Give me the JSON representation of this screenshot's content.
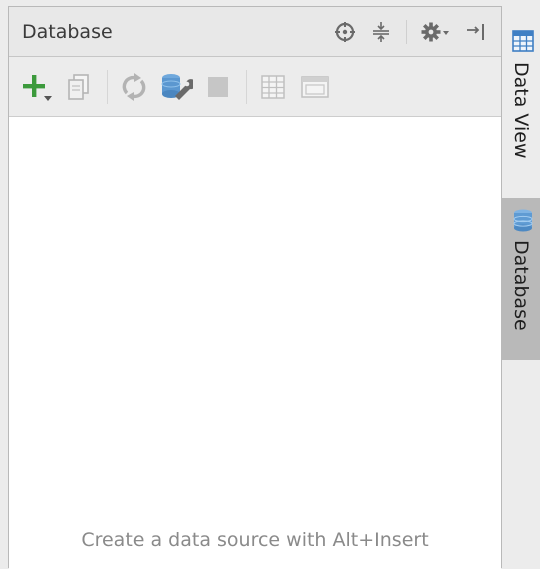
{
  "panel": {
    "title": "Database",
    "empty_message": "Create a data source with Alt+Insert"
  },
  "title_actions": [
    {
      "name": "scroll-from-source-icon"
    },
    {
      "name": "collapse-all-icon"
    },
    {
      "name": "settings-gear-icon"
    },
    {
      "name": "hide-panel-icon"
    }
  ],
  "toolbar": [
    {
      "name": "add-datasource-icon"
    },
    {
      "name": "copy-icon"
    },
    {
      "name": "refresh-icon"
    },
    {
      "name": "datasource-properties-icon"
    },
    {
      "name": "stop-icon"
    },
    {
      "name": "table-view-icon"
    },
    {
      "name": "console-icon"
    }
  ],
  "side_tabs": [
    {
      "label": "Data View",
      "icon": "grid-icon",
      "active": false
    },
    {
      "label": "Database",
      "icon": "database-icon",
      "active": true
    }
  ],
  "colors": {
    "accent_green": "#3c9a3c",
    "icon_blue": "#3f7fc4",
    "stripe_active": "#b9b9b9"
  }
}
